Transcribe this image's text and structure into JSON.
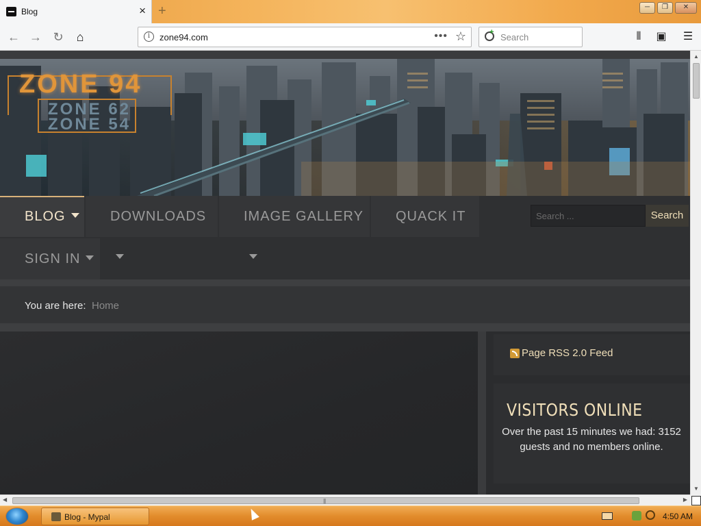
{
  "browser": {
    "tab_title": "Blog",
    "url": "zone94.com",
    "url_actions": "•••",
    "search_placeholder": "Search",
    "window_buttons": {
      "minimize": "─",
      "maximize": "❐",
      "close": "✕"
    }
  },
  "site": {
    "logo": {
      "main": "ZONE 94",
      "sub1": "ZONE 62",
      "sub2": "ZONE 54"
    },
    "menu": [
      {
        "label": "BLOG",
        "has_caret": true,
        "active": true
      },
      {
        "label": "DOWNLOADS",
        "has_caret": true,
        "active": false
      },
      {
        "label": "IMAGE GALLERY",
        "has_caret": true,
        "active": false
      },
      {
        "label": "QUACK IT",
        "has_caret": false,
        "active": false
      },
      {
        "label": "SIGN IN",
        "has_caret": true,
        "active": false
      }
    ],
    "search": {
      "placeholder": "Search ...",
      "button": "Search"
    },
    "breadcrumb": {
      "label": "You are here:",
      "home": "Home"
    },
    "sidebar": {
      "rss_label": "Page RSS 2.0 Feed",
      "visitors_title": "VISITORS ONLINE",
      "visitors_text": "Over the past 15 minutes we had: 3152 guests and no members online."
    }
  },
  "taskbar": {
    "task_label": "Blog - Mypal",
    "clock": "4:50 AM"
  },
  "colors": {
    "accent": "#d9b27a",
    "page_bg": "#2b2c2e",
    "menu_text": "#9a9a9a",
    "active_text": "#f2e4cb",
    "taskbar": "#e28c2c"
  }
}
